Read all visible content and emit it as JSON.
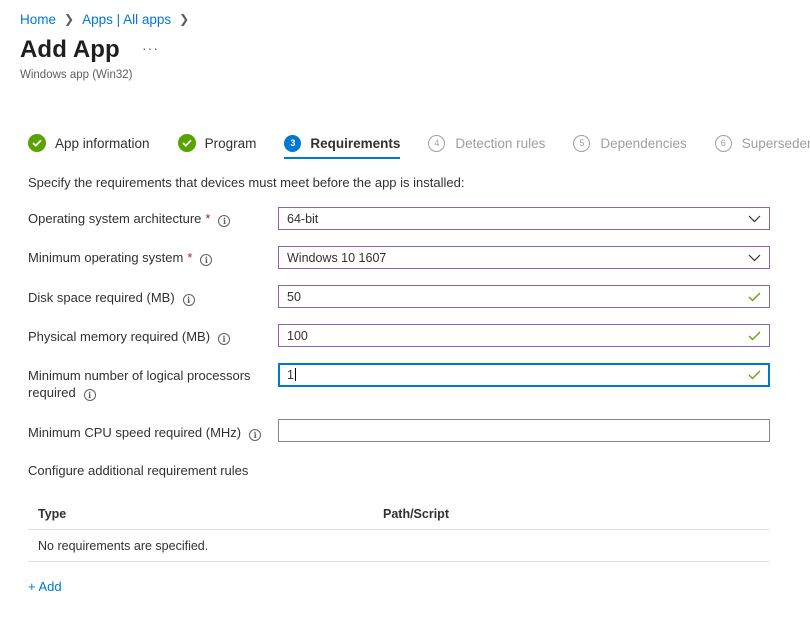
{
  "breadcrumb": {
    "home": "Home",
    "apps": "Apps | All apps",
    "separator": ">"
  },
  "header": {
    "title": "Add App",
    "more": "···",
    "subtitle": "Windows app (Win32)"
  },
  "steps": [
    {
      "label": "App information",
      "status": "done"
    },
    {
      "label": "Program",
      "status": "done"
    },
    {
      "label": "Requirements",
      "number": "3",
      "status": "active"
    },
    {
      "label": "Detection rules",
      "number": "4",
      "status": "pending"
    },
    {
      "label": "Dependencies",
      "number": "5",
      "status": "pending"
    },
    {
      "label": "Supersedence",
      "number": "6",
      "status": "pending"
    }
  ],
  "description": "Specify the requirements that devices must meet before the app is installed:",
  "form": {
    "os_arch": {
      "label": "Operating system architecture",
      "required": "*",
      "value": "64-bit"
    },
    "min_os": {
      "label": "Minimum operating system",
      "required": "*",
      "value": "Windows 10 1607"
    },
    "disk": {
      "label": "Disk space required (MB)",
      "value": "50"
    },
    "memory": {
      "label": "Physical memory required (MB)",
      "value": "100"
    },
    "processors": {
      "label_line1": "Minimum number of logical processors",
      "label_line2": "required",
      "value": "1"
    },
    "cpu": {
      "label": "Minimum CPU speed required (MHz)",
      "value": ""
    }
  },
  "additional": {
    "label": "Configure additional requirement rules",
    "columns": [
      "Type",
      "Path/Script"
    ],
    "empty_message": "No requirements are specified.",
    "add_label": "+ Add"
  },
  "icons": {
    "info": "i",
    "check": "checkmark-icon",
    "chevron": "chevron-down-icon"
  },
  "colors": {
    "accent": "#0078d4",
    "success": "#57a300",
    "valid_border": "#8764b8",
    "required": "#a4262c"
  }
}
